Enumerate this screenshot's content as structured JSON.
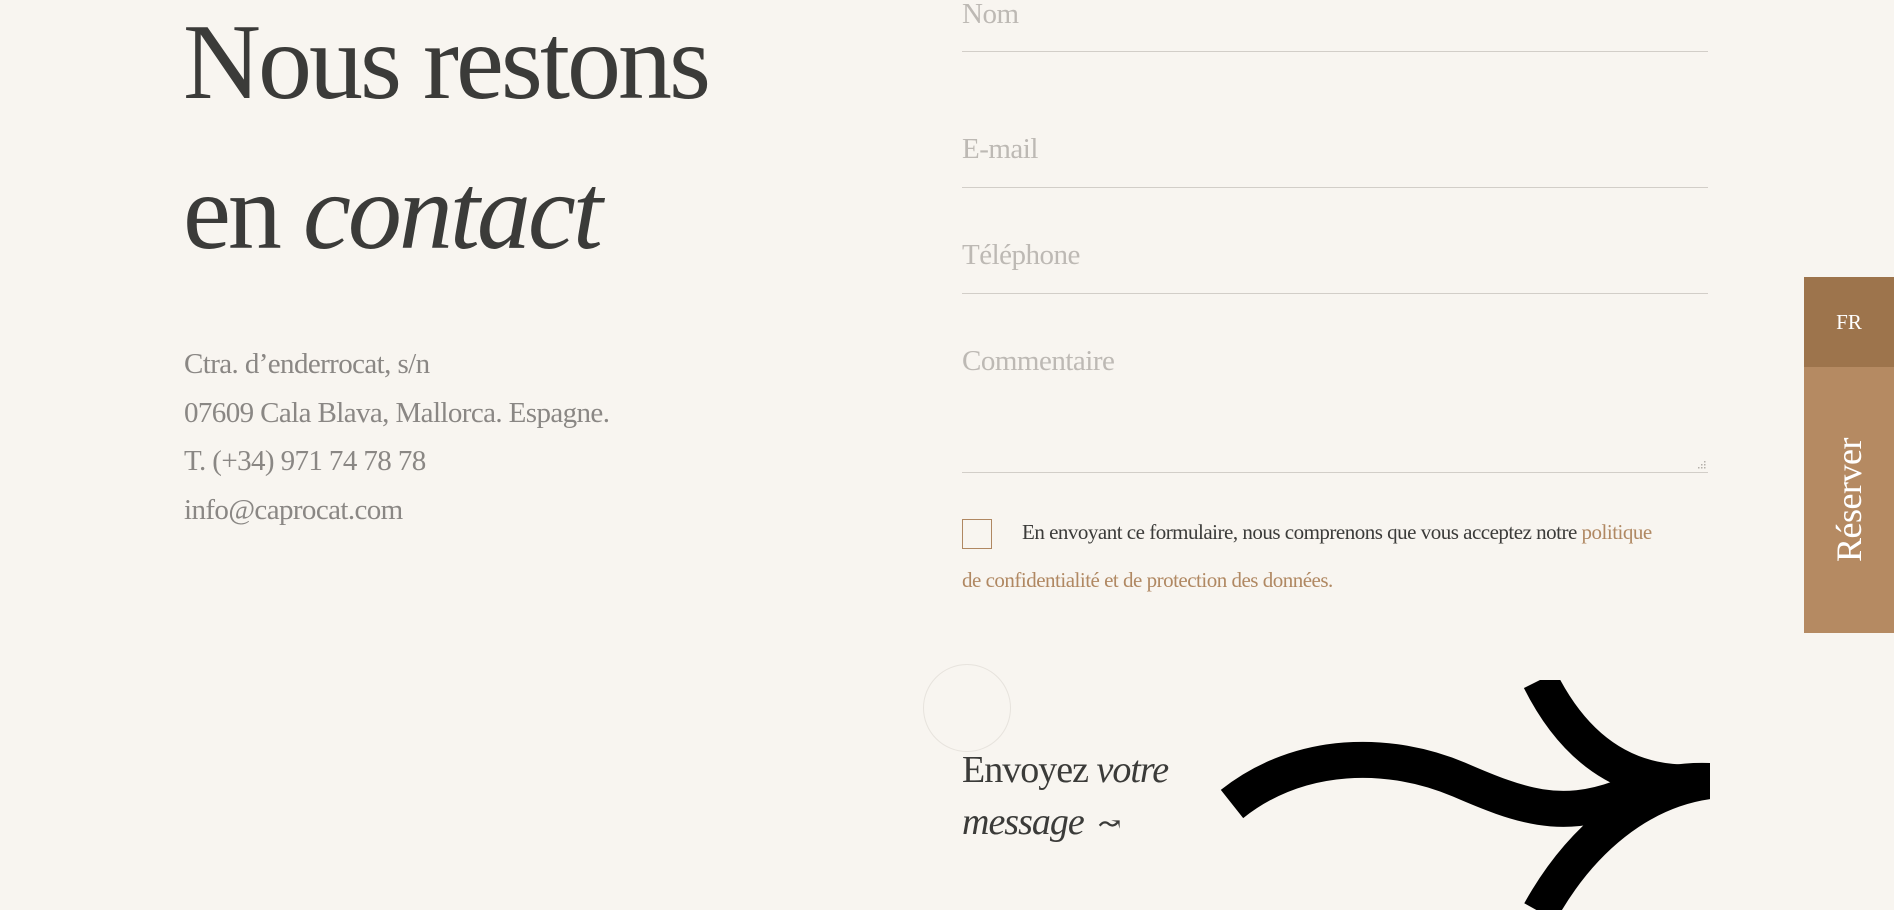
{
  "heading": {
    "line1": "Nous restons",
    "line2_plain": "en ",
    "line2_italic": "contact"
  },
  "address": {
    "street": "Ctra. d’enderrocat, s/n",
    "city": "07609 Cala Blava, Mallorca. Espagne.",
    "phone": "T. (+34) 971 74 78 78",
    "email": "info@caprocat.com"
  },
  "form": {
    "name_placeholder": "Nom",
    "email_placeholder": "E-mail",
    "phone_placeholder": "Téléphone",
    "comment_placeholder": "Commentaire",
    "consent_text": "En envoyant ce formulaire, nous comprenons que vous acceptez notre ",
    "consent_link_part1": "politique",
    "consent_link_part2": "de confidentialité et de protection des données.",
    "consent_checked": false
  },
  "submit": {
    "line1_plain": "Envoyez ",
    "line1_italic": "votre",
    "line2_italic": "message",
    "arrow_glyph": "↝"
  },
  "side": {
    "language": "FR",
    "reserve": "Réserver"
  },
  "colors": {
    "background": "#f8f5f0",
    "text": "#3b3b39",
    "muted": "#8a8784",
    "placeholder": "#bdb9b4",
    "accent": "#b08862",
    "lang_bg": "#9d744c",
    "reserve_bg": "#b58a62"
  },
  "icons": {
    "submit_arrow": "wavy-arrow-icon",
    "big_arrow": "large-wavy-arrow-icon",
    "resize": "resize-grip-icon"
  }
}
